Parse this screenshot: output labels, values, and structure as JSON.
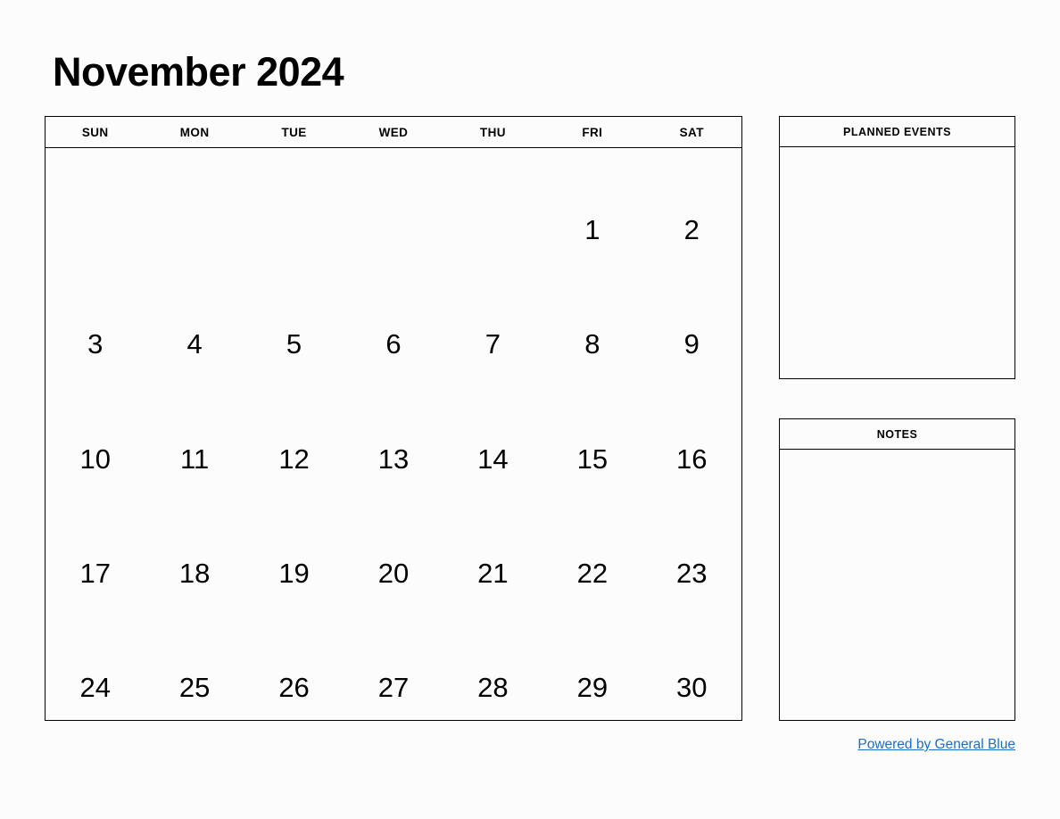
{
  "title": "November 2024",
  "calendar": {
    "weekday_headers": [
      "SUN",
      "MON",
      "TUE",
      "WED",
      "THU",
      "FRI",
      "SAT"
    ],
    "weeks": [
      [
        "",
        "",
        "",
        "",
        "",
        "1",
        "2"
      ],
      [
        "3",
        "4",
        "5",
        "6",
        "7",
        "8",
        "9"
      ],
      [
        "10",
        "11",
        "12",
        "13",
        "14",
        "15",
        "16"
      ],
      [
        "17",
        "18",
        "19",
        "20",
        "21",
        "22",
        "23"
      ],
      [
        "24",
        "25",
        "26",
        "27",
        "28",
        "29",
        "30"
      ]
    ]
  },
  "panels": {
    "planned_events": {
      "header": "PLANNED EVENTS",
      "content": ""
    },
    "notes": {
      "header": "NOTES",
      "content": ""
    }
  },
  "footer": {
    "link_text": "Powered by General Blue",
    "link_color": "#1a6fc4"
  },
  "colors": {
    "background": "#fcfcfc",
    "border": "#000000",
    "text": "#000000",
    "link": "#1a6fc4"
  }
}
